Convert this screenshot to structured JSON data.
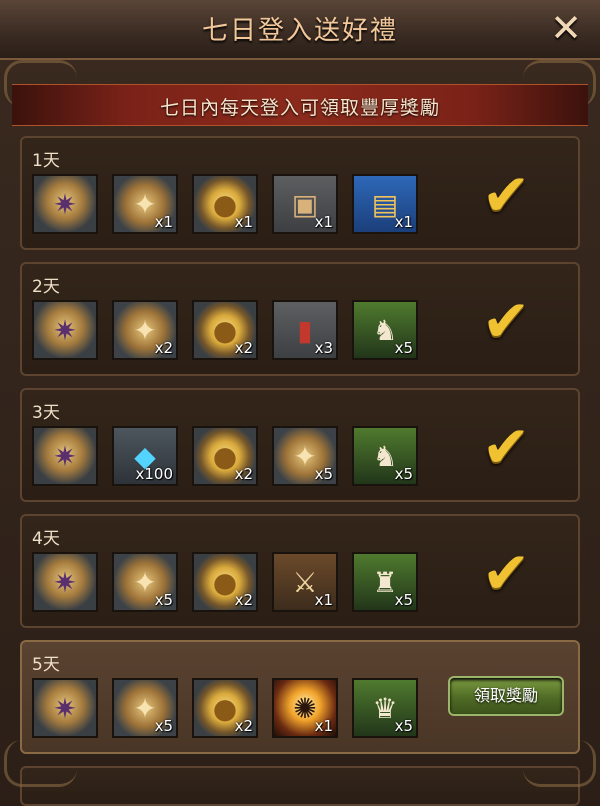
{
  "window": {
    "title": "七日登入送好禮",
    "close_icon": "close-icon"
  },
  "banner": {
    "subtitle": "七日內每天登入可領取豐厚獎勵"
  },
  "days": [
    {
      "label": "1天",
      "status": "claimed",
      "rewards": [
        {
          "icon": "emblem-icon",
          "qty": ""
        },
        {
          "icon": "medal-icon",
          "qty": "x1"
        },
        {
          "icon": "gold-coin-icon",
          "qty": "x1"
        },
        {
          "icon": "open-chest-icon",
          "qty": "x1"
        },
        {
          "icon": "gold-chest-icon",
          "qty": "x1"
        }
      ]
    },
    {
      "label": "2天",
      "status": "claimed",
      "rewards": [
        {
          "icon": "emblem-icon",
          "qty": ""
        },
        {
          "icon": "medal-icon",
          "qty": "x2"
        },
        {
          "icon": "gold-coin-icon",
          "qty": "x2"
        },
        {
          "icon": "red-book-icon",
          "qty": "x3"
        },
        {
          "icon": "cavalry-unit-icon",
          "qty": "x5"
        }
      ]
    },
    {
      "label": "3天",
      "status": "claimed",
      "rewards": [
        {
          "icon": "emblem-icon",
          "qty": ""
        },
        {
          "icon": "diamond-icon",
          "qty": "x100"
        },
        {
          "icon": "gold-coin-icon",
          "qty": "x2"
        },
        {
          "icon": "medal-icon",
          "qty": "x5"
        },
        {
          "icon": "cavalry-unit-icon",
          "qty": "x5"
        }
      ]
    },
    {
      "label": "4天",
      "status": "claimed",
      "rewards": [
        {
          "icon": "emblem-icon",
          "qty": ""
        },
        {
          "icon": "medal-icon",
          "qty": "x5"
        },
        {
          "icon": "gold-coin-icon",
          "qty": "x2"
        },
        {
          "icon": "crossed-swords-scroll-icon",
          "qty": "x1"
        },
        {
          "icon": "archer-unit-icon",
          "qty": "x5"
        }
      ]
    },
    {
      "label": "5天",
      "status": "claimable",
      "rewards": [
        {
          "icon": "emblem-icon",
          "qty": ""
        },
        {
          "icon": "medal-icon",
          "qty": "x5"
        },
        {
          "icon": "gold-coin-icon",
          "qty": "x2"
        },
        {
          "icon": "summon-light-icon",
          "qty": "x1"
        },
        {
          "icon": "mage-unit-icon",
          "qty": "x5"
        }
      ],
      "button_label": "領取獎勵"
    }
  ],
  "colors": {
    "accent_gold": "#f0c232",
    "claim_green": "#5a7a2c",
    "banner_red": "#8a2a1c"
  }
}
